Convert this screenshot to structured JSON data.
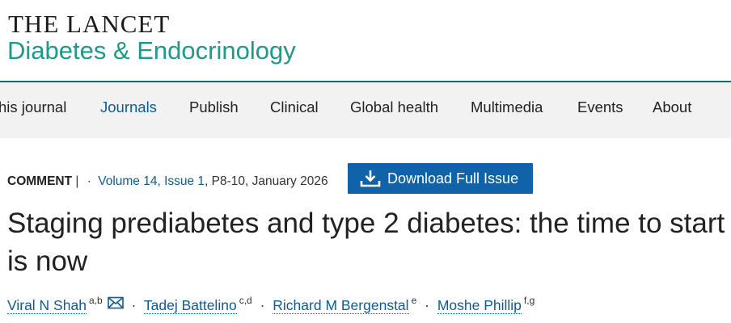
{
  "masthead": {
    "title": "THE LANCET",
    "subtitle": "Diabetes & Endocrinology",
    "subtitle_color": "#1c9a8c"
  },
  "nav": {
    "items": [
      {
        "label": "his journal"
      },
      {
        "label": "Journals",
        "active": true
      },
      {
        "label": "Publish"
      },
      {
        "label": "Clinical"
      },
      {
        "label": "Global health"
      },
      {
        "label": "Multimedia"
      },
      {
        "label": "Events"
      },
      {
        "label": "About"
      }
    ]
  },
  "article": {
    "type": "COMMENT",
    "type_sep": "|",
    "meta_sep": "·",
    "volume_issue": "Volume 14, Issue 1",
    "pages_date": ", P8-10, January 2026",
    "download_label": "Download Full Issue",
    "title": "Staging prediabetes and type 2 diabetes: the time to start is now",
    "author_sep": "·",
    "authors": [
      {
        "name": "Viral N Shah",
        "aff": "a,b",
        "email_icon": "mail-icon"
      },
      {
        "name": "Tadej Battelino",
        "aff": "c,d"
      },
      {
        "name": "Richard M Bergenstal",
        "aff": "e"
      },
      {
        "name": "Moshe Phillip",
        "aff": "f,g"
      }
    ]
  },
  "colors": {
    "link": "#0a5d96",
    "button": "#1063a8",
    "rule": "#0e6e68",
    "nav_bg": "#f2f2f2"
  }
}
